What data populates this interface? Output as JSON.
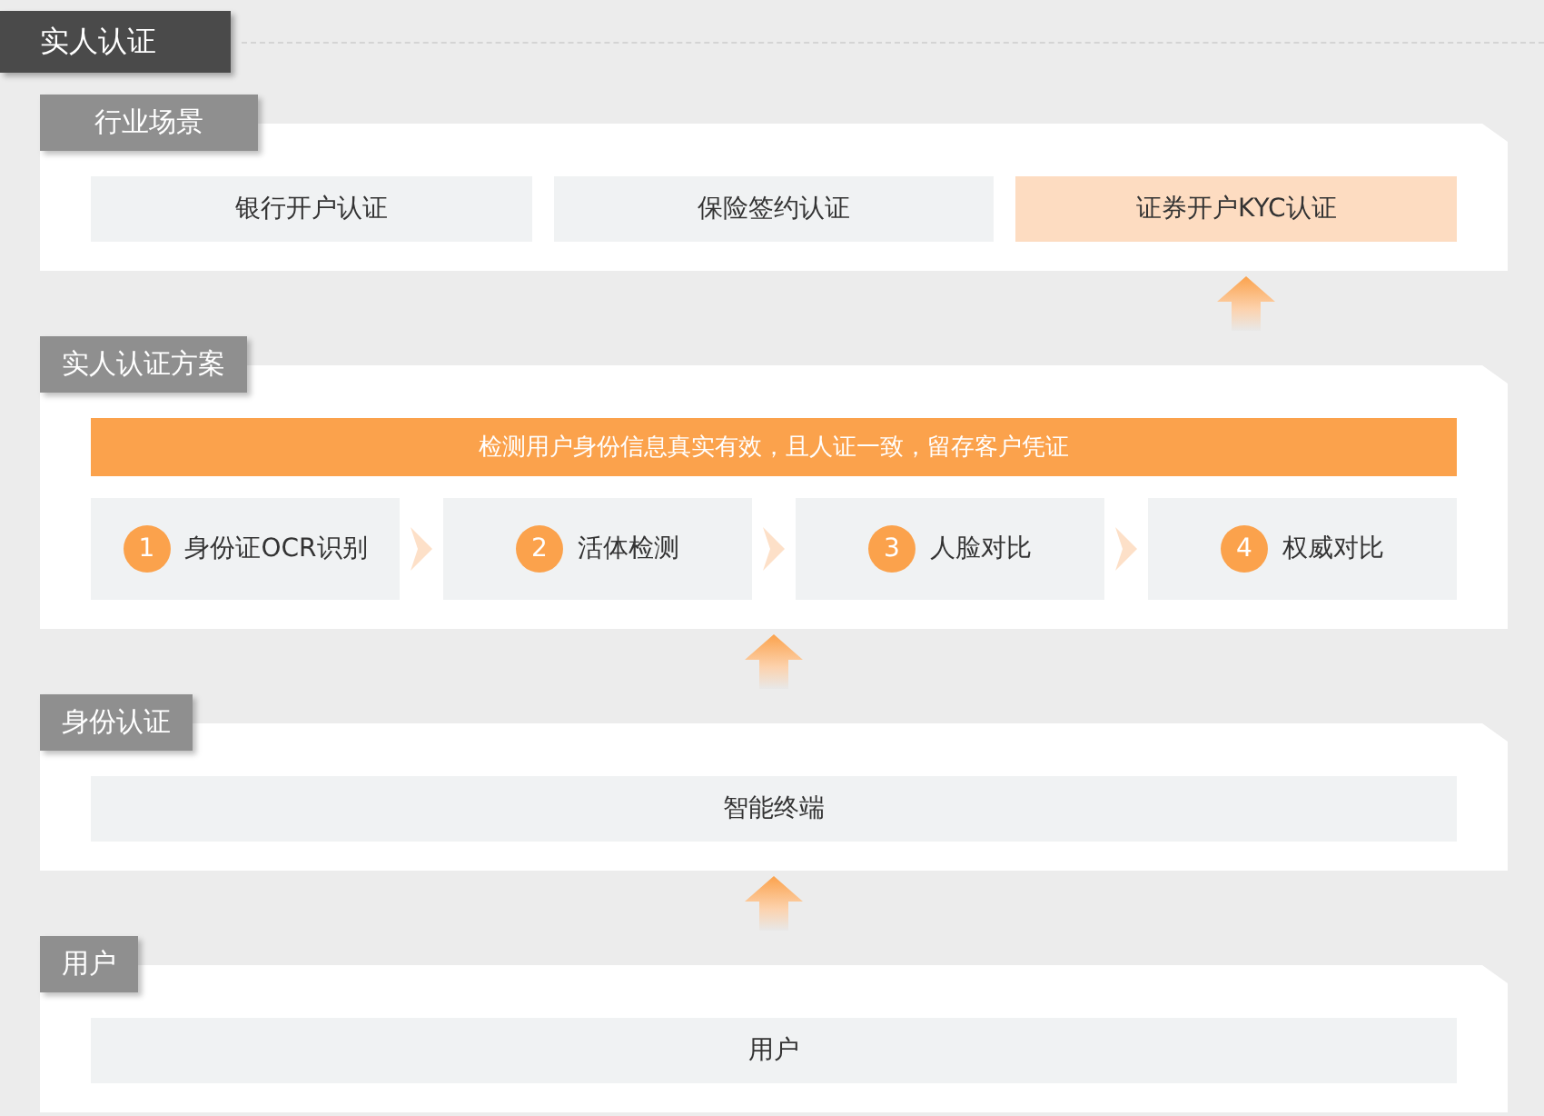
{
  "title": "实人认证",
  "layers": [
    {
      "label": "行业场景",
      "kind": "scenes",
      "items": [
        {
          "text": "银行开户认证",
          "highlighted": false
        },
        {
          "text": "保险签约认证",
          "highlighted": false
        },
        {
          "text": "证券开户KYC认证",
          "highlighted": true
        }
      ]
    },
    {
      "label": "实人认证方案",
      "kind": "steps",
      "banner": "检测用户身份信息真实有效，且人证一致，留存客户凭证",
      "items": [
        {
          "number": "1",
          "text": "身份证OCR识别"
        },
        {
          "number": "2",
          "text": "活体检测"
        },
        {
          "number": "3",
          "text": "人脸对比"
        },
        {
          "number": "4",
          "text": "权威对比"
        }
      ]
    },
    {
      "label": "身份认证",
      "kind": "scenes",
      "items": [
        {
          "text": "智能终端",
          "highlighted": false
        }
      ]
    },
    {
      "label": "用户",
      "kind": "scenes",
      "items": [
        {
          "text": "用户",
          "highlighted": false
        }
      ]
    }
  ]
}
